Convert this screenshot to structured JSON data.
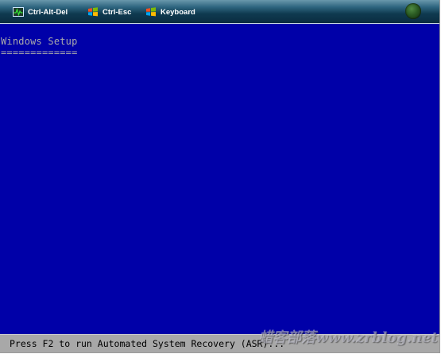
{
  "toolbar": {
    "buttons": [
      {
        "label": "Ctrl-Alt-Del",
        "icon": "task-manager-icon"
      },
      {
        "label": "Ctrl-Esc",
        "icon": "windows-flag-icon"
      },
      {
        "label": "Keyboard",
        "icon": "windows-flag-icon"
      }
    ],
    "status_orb": "windows-orb-icon"
  },
  "console": {
    "title": "Windows Setup",
    "underline": "============="
  },
  "status_bar": {
    "text": "Press F2 to run Automated System Recovery (ASR)..."
  },
  "watermark": {
    "text": "蜡客部落www.zrblog.net"
  },
  "colors": {
    "console_background": "#0000a8",
    "console_text": "#aaaaaa",
    "status_bar_background": "#a8a8a8",
    "toolbar_background": "#1a4a62"
  }
}
